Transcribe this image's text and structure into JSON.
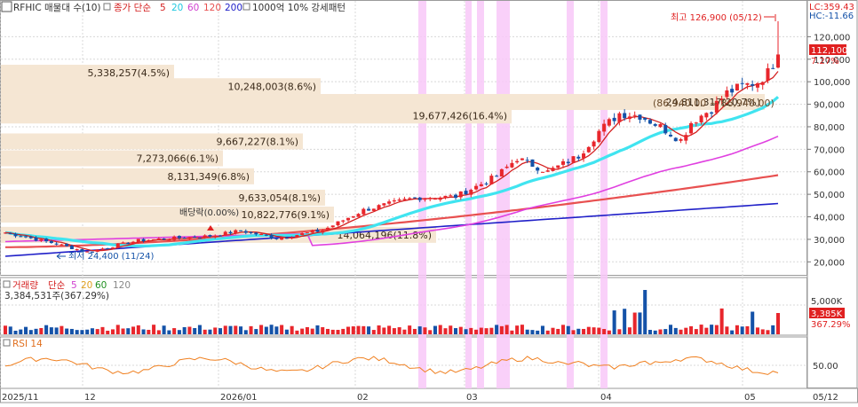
{
  "chart_data": {
    "type": "candlestick",
    "header": {
      "symbol": "RFHIC 매물대 수(10)",
      "ma_label": "종가 단순",
      "ma_periods": [
        "5",
        "20",
        "60",
        "120",
        "200"
      ],
      "pattern_label": "1000억 10% 강세패턴"
    },
    "colors": {
      "up": "#e8262c",
      "down": "#1452a8",
      "ma5": "#d42020",
      "ma20": "#40e4f0",
      "ma60": "#e040e0",
      "ma120": "#e85050",
      "ma200": "#2020c8",
      "volume_profile": "#f5e6d3",
      "highlight": "#f8c8f8",
      "rsi": "#f08020"
    },
    "lc_hc": {
      "lc": "LC:359.43",
      "hc": "HC:-11.66"
    },
    "price_axis": {
      "ticks": [
        "120,000",
        "110,000",
        "100,000",
        "90,000",
        "80,000",
        "70,000",
        "60,000",
        "50,000",
        "40,000",
        "30,000",
        "20,000"
      ],
      "tick_values": [
        120000,
        110000,
        100000,
        90000,
        80000,
        70000,
        60000,
        50000,
        40000,
        30000,
        20000
      ],
      "ylim": [
        15000,
        130000
      ]
    },
    "current_price": {
      "value": "112,100",
      "change": "7.27%",
      "value_num": 112100
    },
    "high_marker": {
      "text": "최고 126,900 (05/12)",
      "value": 126900
    },
    "low_marker": {
      "text": "최저 24,400 (11/24)",
      "value": 24400
    },
    "dividend_label": "배당락(0.00%)",
    "volume_profile": [
      {
        "label": "5,338,257(4.5%)",
        "price": 104000
      },
      {
        "label": "10,248,003(8.6%)",
        "price": 98000
      },
      {
        "label": "24,811,317(20.7%)",
        "price": 91000
      },
      {
        "label": "19,677,426(16.4%)",
        "price": 85000
      },
      {
        "label": "9,667,227(8.1%)",
        "price": 73500
      },
      {
        "label": "7,273,066(6.1%)",
        "price": 66000
      },
      {
        "label": "8,131,349(6.8%)",
        "price": 58000
      },
      {
        "label": "9,633,054(8.1%)",
        "price": 48500
      },
      {
        "label": "10,822,776(9.1%)",
        "price": 41000
      },
      {
        "label": "14,064,196(11.8%)",
        "price": 32000
      }
    ],
    "range_annotation": "(86,940.00 ~ 86,940.00)",
    "x_axis_labels": [
      "2025/11",
      "12",
      "2026/01",
      "02",
      "03",
      "04",
      "05",
      "05/12"
    ],
    "volume_panel": {
      "label": "거래량",
      "ma_label": "단순",
      "ma_periods": [
        "5",
        "20",
        "60",
        "120"
      ],
      "info": "3,384,531주(367.29%)",
      "axis_label": "5,000K",
      "current_value": "3,385K",
      "current_change": "367.29%"
    },
    "rsi_panel": {
      "label": "RSI 14",
      "axis_label": "50.00"
    }
  }
}
